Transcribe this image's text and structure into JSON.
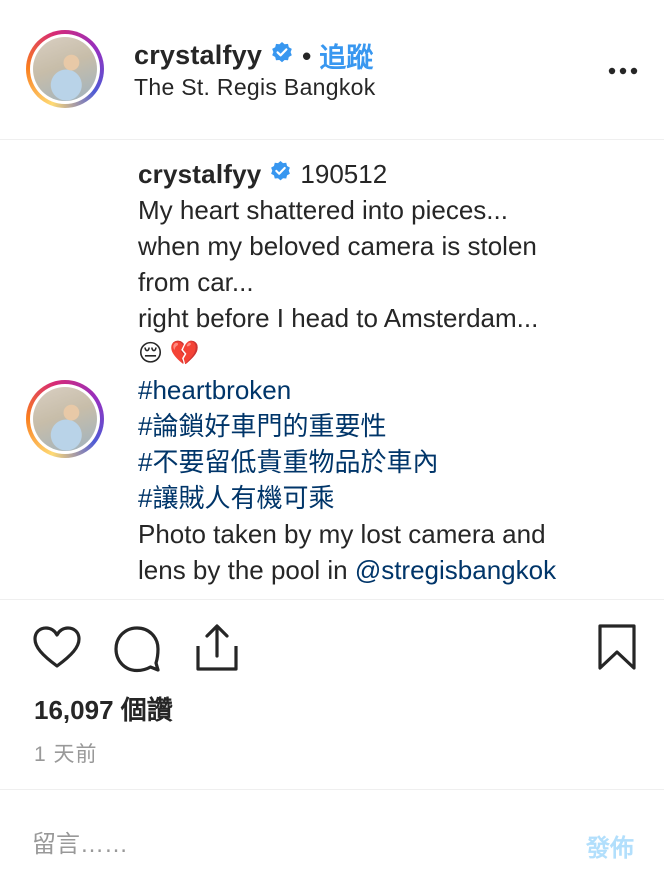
{
  "header": {
    "username": "crystalfyy",
    "separator": "•",
    "follow_label": "追蹤",
    "location": "The St. Regis Bangkok"
  },
  "caption": {
    "username": "crystalfyy",
    "date_text": "190512",
    "lines": [
      "My heart shattered into pieces...",
      "when my beloved camera is stolen",
      "from car...",
      "right before I head to Amsterdam..."
    ],
    "emojis": "😔 💔",
    "hashtags": [
      "#heartbroken",
      "#論鎖好車門的重要性",
      "#不要留低貴重物品於車內",
      "#讓賊人有機可乘"
    ],
    "photo_line_1": "Photo taken by my lost camera and",
    "photo_line_2_prefix": "lens by the pool in ",
    "mention": "@stregisbangkok"
  },
  "stats": {
    "likes": "16,097 個讚",
    "time_ago": "1 天前"
  },
  "comment": {
    "placeholder": "留言……",
    "post_label": "發佈"
  },
  "colors": {
    "verified": "#3897f0",
    "link": "#003569",
    "follow": "#3897f0",
    "post_disabled": "#b2dffc"
  },
  "icons": [
    "verified-badge-icon",
    "more-options-icon",
    "heart-icon",
    "comment-icon",
    "share-icon",
    "bookmark-icon"
  ]
}
